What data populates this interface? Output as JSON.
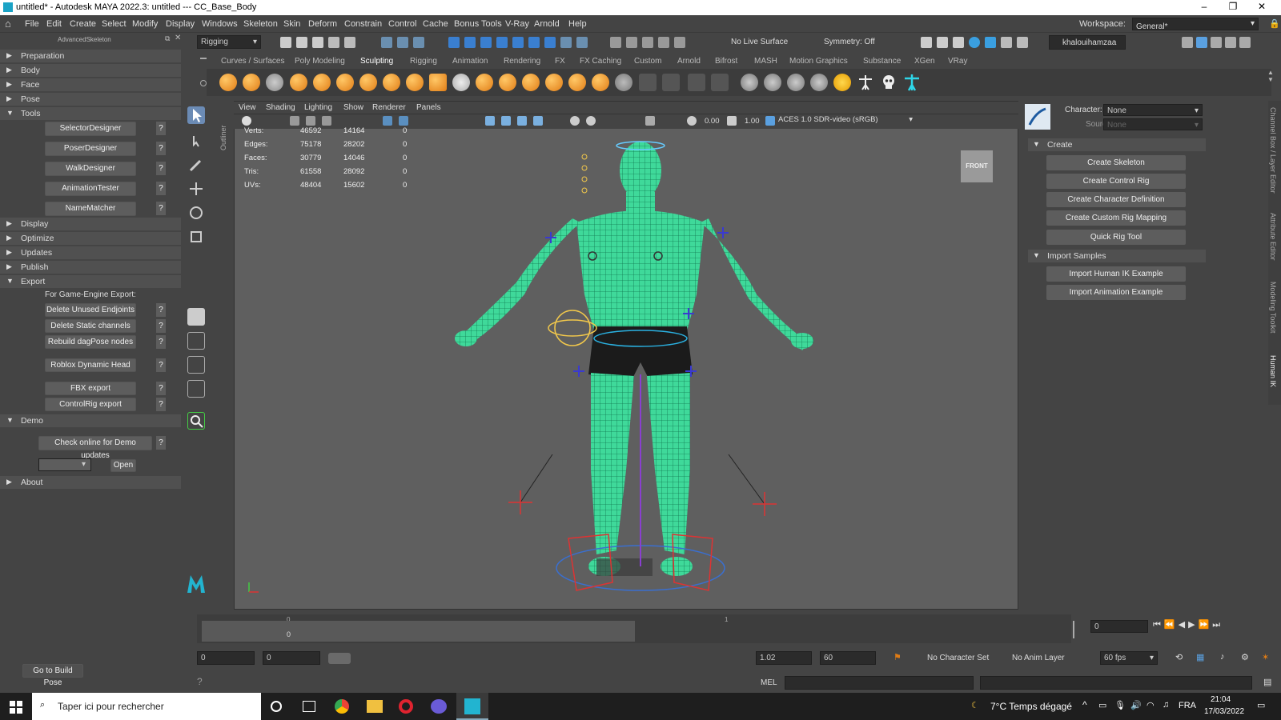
{
  "window": {
    "title": "untitled* - Autodesk MAYA 2022.3: untitled  ---  CC_Base_Body",
    "minimize": "–",
    "maximize": "❐",
    "close": "✕"
  },
  "menu": [
    "File",
    "Edit",
    "Create",
    "Select",
    "Modify",
    "Display",
    "Windows",
    "Skeleton",
    "Skin",
    "Deform",
    "Constrain",
    "Control",
    "Cache",
    "Bonus Tools",
    "V-Ray",
    "Arnold",
    "Help"
  ],
  "workspace": {
    "label": "Workspace:",
    "value": "General*"
  },
  "status": {
    "menuset": "Rigging",
    "live_surface": "No Live Surface",
    "symmetry": "Symmetry: Off",
    "user": "khalouihamzaa"
  },
  "shelf_tabs": [
    "Curves / Surfaces",
    "Poly Modeling",
    "Sculpting",
    "Rigging",
    "Animation",
    "Rendering",
    "FX",
    "FX Caching",
    "Custom",
    "Arnold",
    "Bifrost",
    "MASH",
    "Motion Graphics",
    "Substance",
    "XGen",
    "VRay"
  ],
  "shelf_active": "Sculpting",
  "left_panel": {
    "header": "AdvancedSkeleton",
    "sections": [
      "Preparation",
      "Body",
      "Face",
      "Pose",
      "Tools",
      "Display",
      "Optimize",
      "Updates",
      "Publish",
      "Export",
      "Demo",
      "About"
    ],
    "tools_buttons": [
      "SelectorDesigner",
      "PoserDesigner",
      "WalkDesigner",
      "AnimationTester",
      "NameMatcher"
    ],
    "export_label": "For Game-Engine Export:",
    "export_buttons": [
      "Delete Unused Endjoints",
      "Delete Static channels",
      "Rebuild dagPose nodes",
      "Roblox Dynamic Head",
      "FBX export",
      "ControlRig export"
    ],
    "demo_button": "Check online for Demo updates",
    "open_button": "Open",
    "help": "?",
    "go_build_pose": "Go to Build Pose"
  },
  "outliner_label": "Outliner",
  "viewport": {
    "menu": [
      "View",
      "Shading",
      "Lighting",
      "Show",
      "Renderer",
      "Panels"
    ],
    "val1": "0.00",
    "val2": "1.00",
    "colorspace": "ACES 1.0 SDR-video (sRGB)",
    "cube_label": "FRONT",
    "hud": [
      {
        "label": "Verts:",
        "a": "46592",
        "b": "14164",
        "c": "0"
      },
      {
        "label": "Edges:",
        "a": "75178",
        "b": "28202",
        "c": "0"
      },
      {
        "label": "Faces:",
        "a": "30779",
        "b": "14046",
        "c": "0"
      },
      {
        "label": "Tris:",
        "a": "61558",
        "b": "28092",
        "c": "0"
      },
      {
        "label": "UVs:",
        "a": "48404",
        "b": "15602",
        "c": "0"
      }
    ]
  },
  "hik": {
    "character_label": "Character:",
    "character": "None",
    "source_label": "Source:",
    "source": "None",
    "create": "Create",
    "create_buttons": [
      "Create Skeleton",
      "Create Control Rig",
      "Create Character Definition",
      "Create Custom Rig Mapping",
      "Quick Rig Tool"
    ],
    "import": "Import Samples",
    "import_buttons": [
      "Import Human IK Example",
      "Import Animation Example"
    ]
  },
  "right_tabs": [
    "Channel Box / Layer Editor",
    "Attribute Editor",
    "Modeling Toolkit",
    "Human IK"
  ],
  "timeline": {
    "tick0": "0",
    "tick1": "1",
    "current": "0",
    "frame_field": "0"
  },
  "range": {
    "start": "0",
    "start2": "0",
    "end_val": "1.02",
    "end": "60",
    "char_set": "No Character Set",
    "anim_layer": "No Anim Layer",
    "fps": "60 fps"
  },
  "cmd": {
    "lang": "MEL"
  },
  "taskbar": {
    "search": "Taper ici pour rechercher",
    "weather": "7°C  Temps dégagé",
    "lang": "FRA",
    "time": "21:04",
    "date": "17/03/2022"
  }
}
